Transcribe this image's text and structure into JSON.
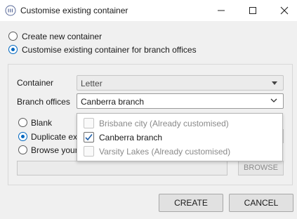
{
  "window": {
    "title": "Customise existing container",
    "icon": "app-logo-icon"
  },
  "mode_options": [
    {
      "label": "Create new container",
      "checked": false
    },
    {
      "label": "Customise existing container for branch offices",
      "checked": true
    }
  ],
  "form": {
    "container_label": "Container",
    "container_value": "Letter",
    "branch_label": "Branch offices",
    "branch_value": "Canberra branch"
  },
  "source_options": [
    {
      "label": "Blank",
      "checked": false
    },
    {
      "label": "Duplicate ex",
      "checked": true
    },
    {
      "label": "Browse your",
      "checked": false
    }
  ],
  "browse": {
    "label": "BROWSE",
    "path_value": ""
  },
  "branch_dropdown": {
    "items": [
      {
        "label": "Brisbane city (Already customised)",
        "checked": false,
        "disabled": true
      },
      {
        "label": "Canberra branch",
        "checked": true,
        "disabled": false
      },
      {
        "label": "Varsity Lakes (Already customised)",
        "checked": false,
        "disabled": true
      }
    ]
  },
  "actions": {
    "create_label": "CREATE",
    "cancel_label": "CANCEL"
  },
  "colors": {
    "accent": "#0067c0",
    "window_bg": "#f0f0f0",
    "titlebar_bg": "#ffffff"
  }
}
